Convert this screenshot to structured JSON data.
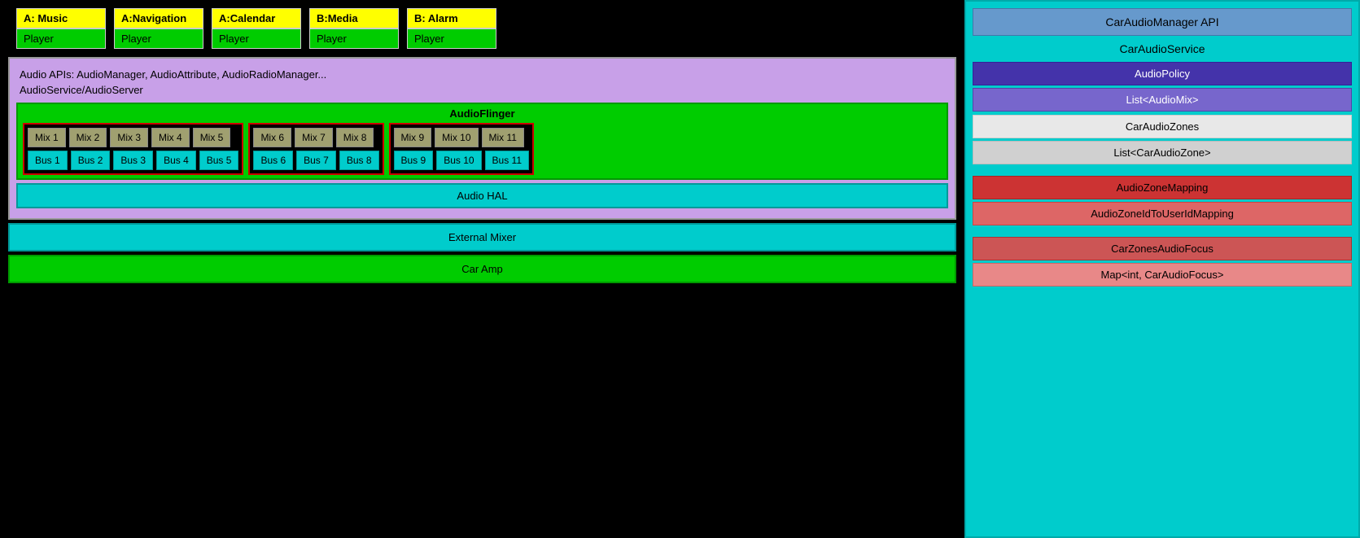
{
  "diagram": {
    "app_players": [
      {
        "label": "A: Music",
        "player": "Player"
      },
      {
        "label": "A:Navigation",
        "player": "Player"
      },
      {
        "label": "A:Calendar",
        "player": "Player"
      },
      {
        "label": "B:Media",
        "player": "Player"
      },
      {
        "label": "B: Alarm",
        "player": "Player"
      }
    ],
    "audio_apis_label": "Audio APIs: AudioManager, AudioAttribute, AudioRadioManager...",
    "audio_service_label": "AudioService/AudioServer",
    "audio_flinger_label": "AudioFlinger",
    "mix_groups": [
      {
        "mixes": [
          "Mix 1",
          "Mix 2",
          "Mix 3",
          "Mix 4",
          "Mix 5"
        ],
        "buses": [
          "Bus 1",
          "Bus 2",
          "Bus 3",
          "Bus 4",
          "Bus 5"
        ]
      },
      {
        "mixes": [
          "Mix 6",
          "Mix 7",
          "Mix 8"
        ],
        "buses": [
          "Bus 6",
          "Bus 7",
          "Bus 8"
        ]
      },
      {
        "mixes": [
          "Mix 9",
          "Mix 10",
          "Mix 11"
        ],
        "buses": [
          "Bus 9",
          "Bus 10",
          "Bus 11"
        ]
      }
    ],
    "audio_hal_label": "Audio HAL",
    "external_mixer_label": "External Mixer",
    "car_amp_label": "Car Amp"
  },
  "right_panel": {
    "api_title": "CarAudioManager API",
    "service_title": "CarAudioService",
    "audio_policy": "AudioPolicy",
    "list_audio_mix": "List<AudioMix>",
    "car_audio_zones": "CarAudioZones",
    "list_car_audio_zone": "List<CarAudioZone>",
    "audio_zone_mapping": "AudioZoneMapping",
    "audio_zone_id_to_user": "AudioZoneIdToUserIdMapping",
    "car_zones_audio_focus": "CarZonesAudioFocus",
    "map_car_audio_focus": "Map<int, CarAudioFocus>"
  }
}
